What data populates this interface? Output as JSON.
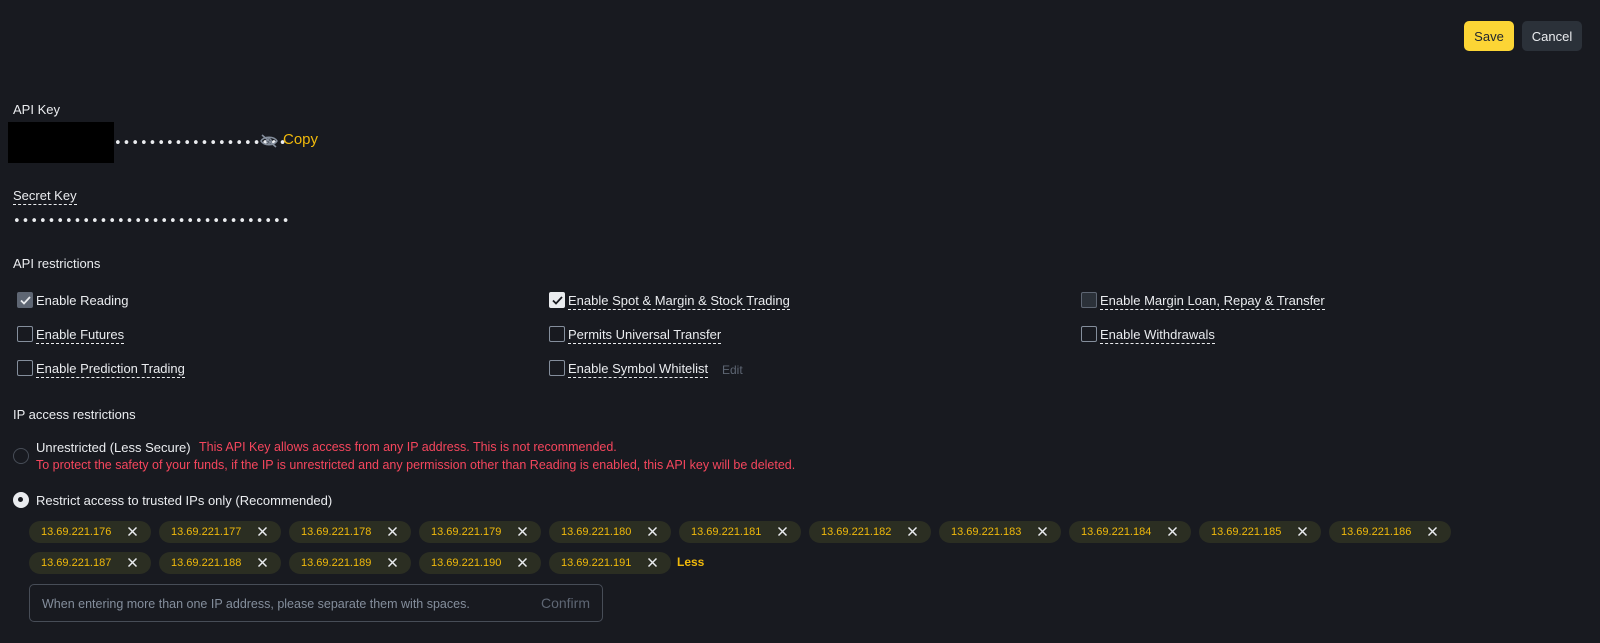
{
  "actions": {
    "save_label": "Save",
    "cancel_label": "Cancel"
  },
  "api_key": {
    "label": "API Key",
    "masked_value": "••••••••••••••••••••",
    "copy_label": "Copy",
    "visibility_icon": "eye-off-icon"
  },
  "secret_key": {
    "label": "Secret Key",
    "masked_value": "••••••••••••••••••••••••••••••••"
  },
  "api_restrictions": {
    "title": "API restrictions",
    "options": [
      {
        "label": "Enable Reading",
        "checked": true,
        "disabled": true
      },
      {
        "label": "Enable Spot & Margin & Stock Trading",
        "checked": true,
        "disabled": false
      },
      {
        "label": "Enable Margin Loan, Repay & Transfer",
        "checked": false,
        "disabled": true
      },
      {
        "label": "Enable Futures",
        "checked": false,
        "disabled": false
      },
      {
        "label": "Permits Universal Transfer",
        "checked": false,
        "disabled": false
      },
      {
        "label": "Enable Withdrawals",
        "checked": false,
        "disabled": false
      },
      {
        "label": "Enable Prediction Trading",
        "checked": false,
        "disabled": false
      },
      {
        "label": "Enable Symbol Whitelist",
        "checked": false,
        "disabled": false
      }
    ],
    "edit_label": "Edit"
  },
  "ip_access": {
    "title": "IP access restrictions",
    "unrestricted_label": "Unrestricted (Less Secure)",
    "unrestricted_warning_1": "This API Key allows access from any IP address. This is not recommended.",
    "unrestricted_warning_2": "To protect the safety of your funds, if the IP is unrestricted and any permission other than Reading is enabled, this API key will be deleted.",
    "restricted_label": "Restrict access to trusted IPs only (Recommended)",
    "selected": "restricted",
    "ips": [
      "13.69.221.176",
      "13.69.221.177",
      "13.69.221.178",
      "13.69.221.179",
      "13.69.221.180",
      "13.69.221.181",
      "13.69.221.182",
      "13.69.221.183",
      "13.69.221.184",
      "13.69.221.185",
      "13.69.221.186",
      "13.69.221.187",
      "13.69.221.188",
      "13.69.221.189",
      "13.69.221.190",
      "13.69.221.191"
    ],
    "less_label": "Less",
    "input_placeholder": "When entering more than one IP address, please separate them with spaces.",
    "input_value": "",
    "confirm_label": "Confirm"
  },
  "colors": {
    "background": "#181a20",
    "accent": "#fcd535",
    "chip_text": "#f0b90b",
    "warning": "#f6465d"
  }
}
